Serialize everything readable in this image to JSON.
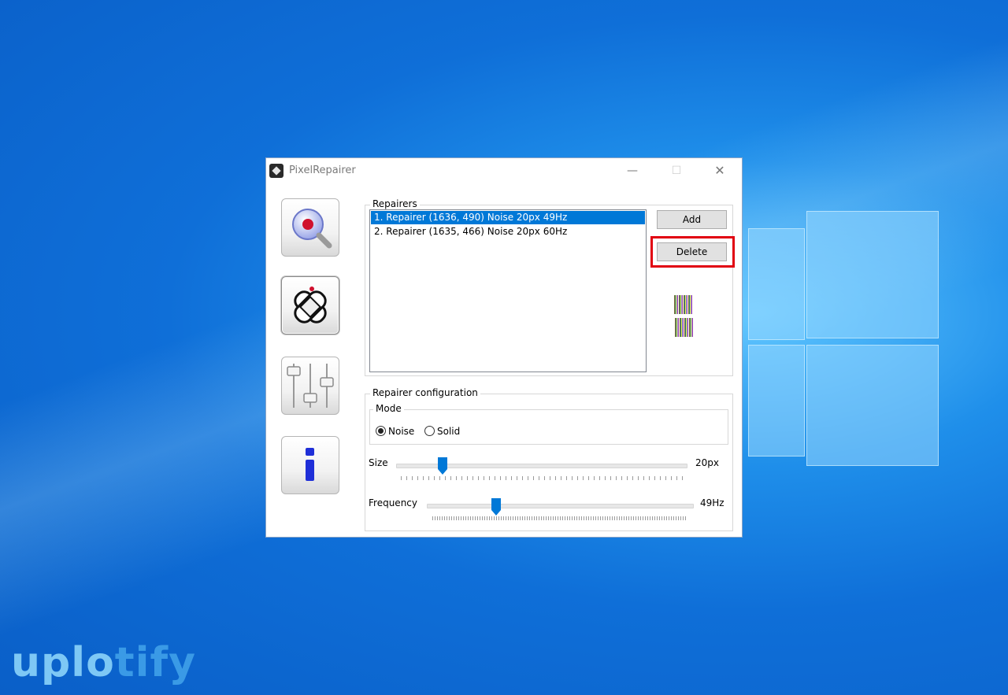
{
  "window": {
    "title": "PixelRepairer",
    "controls": {
      "minimize": "—",
      "maximize": "☐",
      "close": "✕"
    }
  },
  "sidebar": {
    "items": [
      {
        "name": "locate-tool",
        "icon": "magnifier-icon"
      },
      {
        "name": "repair-tool",
        "icon": "bandage-icon",
        "active": true
      },
      {
        "name": "settings-tool",
        "icon": "sliders-icon"
      },
      {
        "name": "about-tool",
        "icon": "info-icon"
      }
    ]
  },
  "repairers": {
    "label": "Repairers",
    "items": [
      {
        "text": "1. Repairer (1636, 490) Noise 20px 49Hz",
        "selected": true
      },
      {
        "text": "2. Repairer (1635, 466) Noise 20px 60Hz",
        "selected": false
      }
    ],
    "add_label": "Add",
    "delete_label": "Delete"
  },
  "config": {
    "label": "Repairer configuration",
    "mode": {
      "label": "Mode",
      "options": [
        "Noise",
        "Solid"
      ],
      "selected": "Noise"
    },
    "size": {
      "label": "Size",
      "value_text": "20px",
      "fraction": 0.16
    },
    "frequency": {
      "label": "Frequency",
      "value_text": "49Hz",
      "fraction": 0.26
    }
  },
  "watermark": {
    "part1": "uplo",
    "part2": "tify"
  },
  "colors": {
    "selection": "#0078d7",
    "highlight": "#e10010",
    "slider_thumb": "#0078d7"
  }
}
